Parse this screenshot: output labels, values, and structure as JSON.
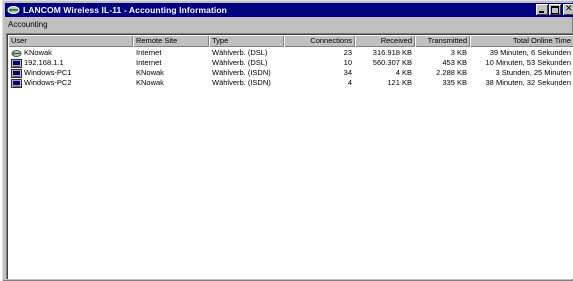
{
  "window": {
    "title": "LANCOM Wireless IL-11 - Accounting Information",
    "app_icon": "lancom-icon",
    "buttons": [
      "minimize-icon",
      "maximize-icon",
      "close-icon"
    ]
  },
  "menu": {
    "items": [
      {
        "label": "Accounting"
      }
    ]
  },
  "table": {
    "columns": [
      {
        "label": "User"
      },
      {
        "label": "Remote Site"
      },
      {
        "label": "Type"
      },
      {
        "label": "Connections"
      },
      {
        "label": "Received"
      },
      {
        "label": "Transmitted"
      },
      {
        "label": "Total Online Time"
      }
    ],
    "rows": [
      {
        "icon": "connection-icon",
        "user": "KNowak",
        "remote_site": "Internet",
        "type": "Wählverb. (DSL)",
        "connections": "23",
        "received": "316.918 KB",
        "transmitted": "3 KB",
        "online_time": "39 Minuten, 6 Sekunden"
      },
      {
        "icon": "computer-icon",
        "user": "192.168.1.1",
        "remote_site": "Internet",
        "type": "Wählverb. (DSL)",
        "connections": "10",
        "received": "560.307 KB",
        "transmitted": "453 KB",
        "online_time": "10 Minuten, 53 Sekunden"
      },
      {
        "icon": "computer-icon",
        "user": "Windows-PC1",
        "remote_site": "KNowak",
        "type": "Wählverb. (ISDN)",
        "connections": "34",
        "received": "4 KB",
        "transmitted": "2.288 KB",
        "online_time": "3 Stunden, 25 Minuten"
      },
      {
        "icon": "computer-icon",
        "user": "Windows-PC2",
        "remote_site": "KNowak",
        "type": "Wählverb. (ISDN)",
        "connections": "4",
        "received": "121 KB",
        "transmitted": "335 KB",
        "online_time": "38 Minuten, 32 Sekunden"
      }
    ]
  },
  "colors": {
    "titlebar": "#000080",
    "window_face": "#c0c0c0",
    "list_background": "#ffffff"
  }
}
